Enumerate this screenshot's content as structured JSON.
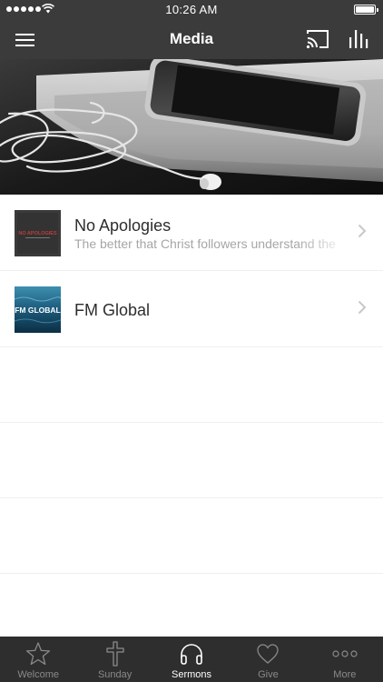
{
  "status_bar": {
    "time": "10:26 AM"
  },
  "nav": {
    "title": "Media"
  },
  "list": {
    "items": [
      {
        "title": "No Apologies",
        "subtitle": "The better that Christ followers understand the",
        "thumb_text": "NO APOLOGIES"
      },
      {
        "title": "FM Global",
        "subtitle": "",
        "thumb_text": "FM GLOBAL"
      }
    ]
  },
  "tabs": [
    {
      "label": "Welcome",
      "icon": "star-icon"
    },
    {
      "label": "Sunday",
      "icon": "cross-icon"
    },
    {
      "label": "Sermons",
      "icon": "headphones-icon",
      "active": true
    },
    {
      "label": "Give",
      "icon": "heart-icon"
    },
    {
      "label": "More",
      "icon": "more-dots-icon"
    }
  ],
  "colors": {
    "nav_background": "#3b3b3b",
    "tab_background": "#2e2e2e",
    "tab_inactive": "#8a8a8a",
    "tab_active": "#ffffff"
  }
}
